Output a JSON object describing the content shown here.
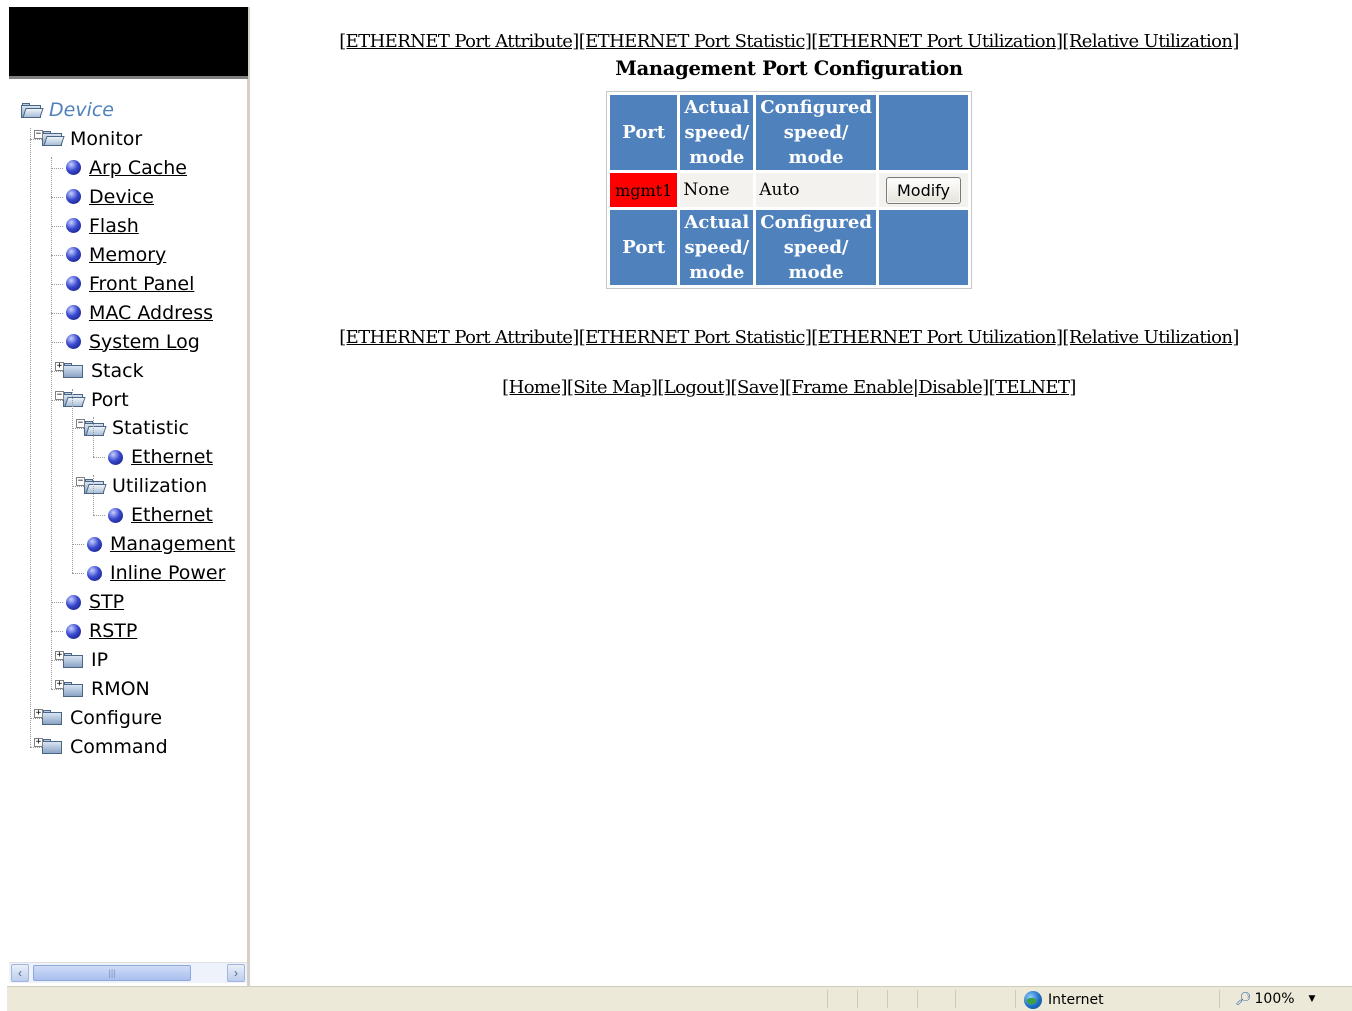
{
  "sidebar": {
    "tree": [
      {
        "label": "Device",
        "kind": "folder-open",
        "link": false,
        "indent": 0
      },
      {
        "label": "Monitor",
        "kind": "folder-open",
        "link": false,
        "indent": 1,
        "expander": "−"
      },
      {
        "label": "Arp Cache",
        "kind": "leaf",
        "link": true,
        "indent": 2
      },
      {
        "label": "Device",
        "kind": "leaf",
        "link": true,
        "indent": 2
      },
      {
        "label": "Flash",
        "kind": "leaf",
        "link": true,
        "indent": 2
      },
      {
        "label": "Memory",
        "kind": "leaf",
        "link": true,
        "indent": 2
      },
      {
        "label": "Front Panel",
        "kind": "leaf",
        "link": true,
        "indent": 2
      },
      {
        "label": "MAC Address",
        "kind": "leaf",
        "link": true,
        "indent": 2
      },
      {
        "label": "System Log",
        "kind": "leaf",
        "link": true,
        "indent": 2
      },
      {
        "label": "Stack",
        "kind": "folder",
        "link": false,
        "indent": 2,
        "expander": "+"
      },
      {
        "label": "Port",
        "kind": "folder-open",
        "link": false,
        "indent": 2,
        "expander": "−"
      },
      {
        "label": "Statistic",
        "kind": "folder-open",
        "link": false,
        "indent": 3,
        "expander": "−"
      },
      {
        "label": "Ethernet",
        "kind": "leaf",
        "link": true,
        "indent": 4
      },
      {
        "label": "Utilization",
        "kind": "folder-open",
        "link": false,
        "indent": 3,
        "expander": "−"
      },
      {
        "label": "Ethernet",
        "kind": "leaf",
        "link": true,
        "indent": 4
      },
      {
        "label": "Management",
        "kind": "leaf",
        "link": true,
        "indent": 3
      },
      {
        "label": "Inline Power",
        "kind": "leaf",
        "link": true,
        "indent": 3
      },
      {
        "label": "STP",
        "kind": "leaf",
        "link": true,
        "indent": 2
      },
      {
        "label": "RSTP",
        "kind": "leaf",
        "link": true,
        "indent": 2
      },
      {
        "label": "IP",
        "kind": "folder",
        "link": false,
        "indent": 2,
        "expander": "+"
      },
      {
        "label": "RMON",
        "kind": "folder",
        "link": false,
        "indent": 2,
        "expander": "+"
      },
      {
        "label": "Configure",
        "kind": "folder",
        "link": false,
        "indent": 1,
        "expander": "+"
      },
      {
        "label": "Command",
        "kind": "folder",
        "link": false,
        "indent": 1,
        "expander": "+"
      }
    ],
    "scrollbar": {
      "left_arrow": "‹",
      "right_arrow": "›",
      "thumb_grip": "|||"
    }
  },
  "top_nav": {
    "links": [
      "[ETHERNET Port Attribute]",
      "[ETHERNET Port Statistic]",
      "[ETHERNET Port Utilization]",
      "[Relative Utilization]"
    ]
  },
  "page_title": "Management Port Configuration",
  "table": {
    "headers": [
      "Port",
      "Actual speed/ mode",
      "Configured speed/ mode",
      ""
    ],
    "header_lines": [
      [
        "Port"
      ],
      [
        "Actual",
        "speed/",
        "mode"
      ],
      [
        "Configured",
        "speed/",
        "mode"
      ],
      [
        ""
      ]
    ],
    "rows": [
      {
        "port": "mgmt1",
        "actual": "None",
        "configured": "Auto",
        "action": "Modify"
      }
    ]
  },
  "bottom_nav": {
    "links": [
      "[Home]",
      "[Site Map]",
      "[Logout]",
      "[Save]",
      "[Frame Enable|Disable]",
      "[TELNET]"
    ]
  },
  "statusbar": {
    "zone": "Internet",
    "zoom": "100%",
    "zoom_icon": "magnifier-icon",
    "zone_icon": "globe-icon"
  },
  "colors": {
    "header_blue": "#4f81bd",
    "port_highlight": "#ff0000"
  }
}
